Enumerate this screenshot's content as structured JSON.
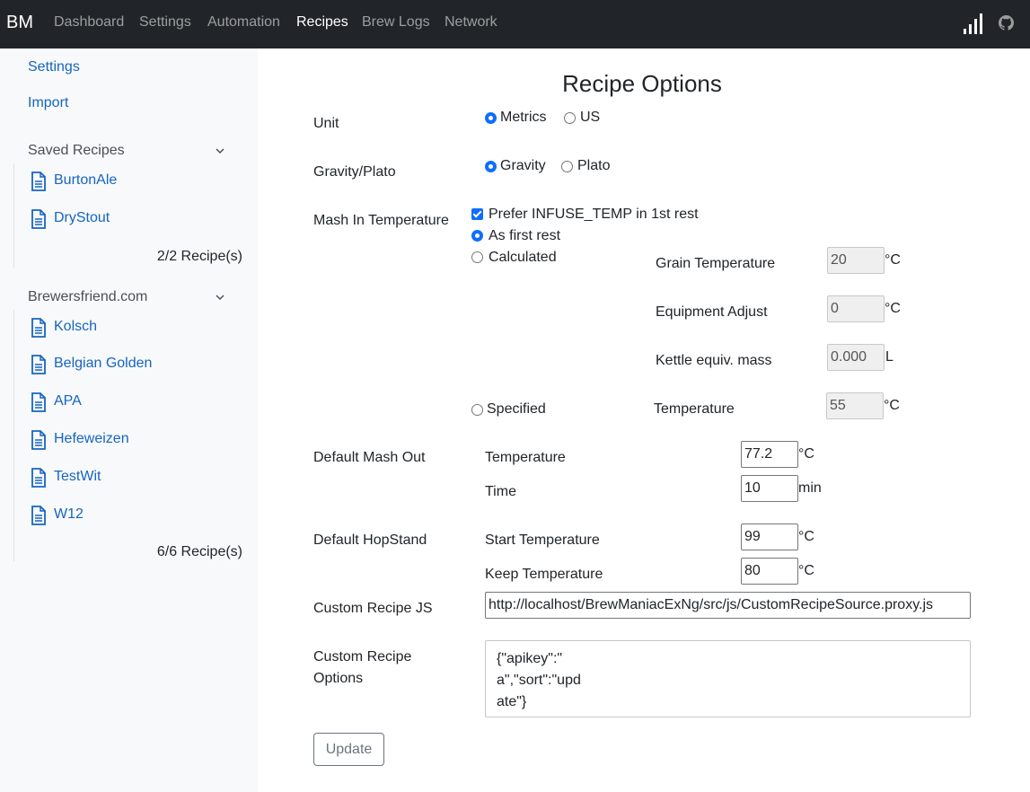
{
  "brand": "BM",
  "nav": [
    "Dashboard",
    "Settings",
    "Automation",
    "Recipes",
    "Brew Logs",
    "Network"
  ],
  "sidebar": {
    "settings": "Settings",
    "import": "Import",
    "groups": [
      {
        "title": "Saved Recipes",
        "items": [
          "BurtonAle",
          "DryStout"
        ],
        "count": "2/2 Recipe(s)"
      },
      {
        "title": "Brewersfriend.com",
        "items": [
          "Kolsch",
          "Belgian Golden",
          "APA",
          "Hefeweizen",
          "TestWit",
          "W12"
        ],
        "count": "6/6 Recipe(s)"
      }
    ]
  },
  "main": {
    "title": "Recipe Options",
    "unit": {
      "label": "Unit",
      "options": [
        "Metrics",
        "US"
      ],
      "selected": "Metrics"
    },
    "gravity": {
      "label": "Gravity/Plato",
      "options": [
        "Gravity",
        "Plato"
      ],
      "selected": "Gravity"
    },
    "mash_in": {
      "label": "Mash In Temperature",
      "prefer_infuse": "Prefer INFUSE_TEMP in 1st rest",
      "as_first_rest": "As first rest",
      "calculated": "Calculated",
      "specified": "Specified",
      "selected": "As first rest",
      "grain_temp": {
        "label": "Grain Temperature",
        "value": "20",
        "unit": "°C"
      },
      "equip_adjust": {
        "label": "Equipment Adjust",
        "value": "0",
        "unit": "°C"
      },
      "kettle_mass": {
        "label": "Kettle equiv. mass",
        "value": "0.000",
        "unit": "L"
      },
      "specified_temp": {
        "label": "Temperature",
        "value": "55",
        "unit": "°C"
      }
    },
    "mash_out": {
      "label": "Default Mash Out",
      "temp": {
        "label": "Temperature",
        "value": "77.2",
        "unit": "°C"
      },
      "time": {
        "label": "Time",
        "value": "10",
        "unit": "min"
      }
    },
    "hopstand": {
      "label": "Default HopStand",
      "start": {
        "label": "Start Temperature",
        "value": "99",
        "unit": "°C"
      },
      "keep": {
        "label": "Keep Temperature",
        "value": "80",
        "unit": "°C"
      }
    },
    "custom_js": {
      "label": "Custom Recipe JS",
      "value": "http://localhost/BrewManiacExNg/src/js/CustomRecipeSource.proxy.js"
    },
    "custom_options": {
      "label_line1": "Custom Recipe",
      "label_line2": "Options",
      "value": "{\"apikey\":\"\na\",\"sort\":\"upd\nate\"}"
    },
    "update_button": "Update"
  }
}
